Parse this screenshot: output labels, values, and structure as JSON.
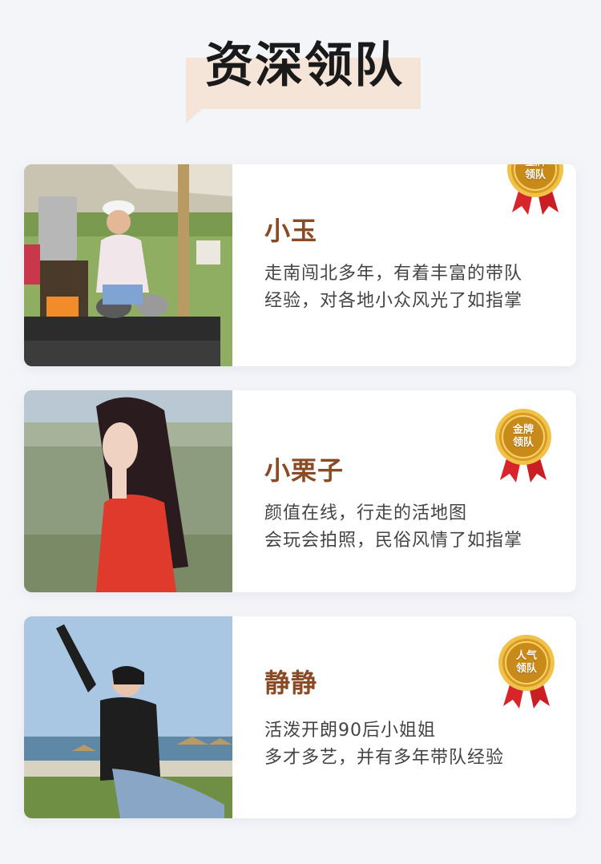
{
  "header": {
    "title": "资深领队"
  },
  "leaders": [
    {
      "name": "小玉",
      "badge": [
        "金牌",
        "领队"
      ],
      "lines": [
        "走南闯北多年，有着丰富的带队",
        "经验，对各地小众风光了如指掌"
      ]
    },
    {
      "name": "小栗子",
      "badge": [
        "金牌",
        "领队"
      ],
      "lines": [
        "颜值在线，行走的活地图",
        "会玩会拍照，民俗风情了如指掌"
      ]
    },
    {
      "name": "静静",
      "badge": [
        "人气",
        "领队"
      ],
      "lines": [
        "活泼开朗90后小姐姐",
        "多才多艺，并有多年带队经验"
      ]
    }
  ],
  "colors": {
    "name": "#8a4a24",
    "title_bg": "#f5e4d8",
    "medal_gold": "#d9a030",
    "medal_ribbon": "#d8252b"
  }
}
